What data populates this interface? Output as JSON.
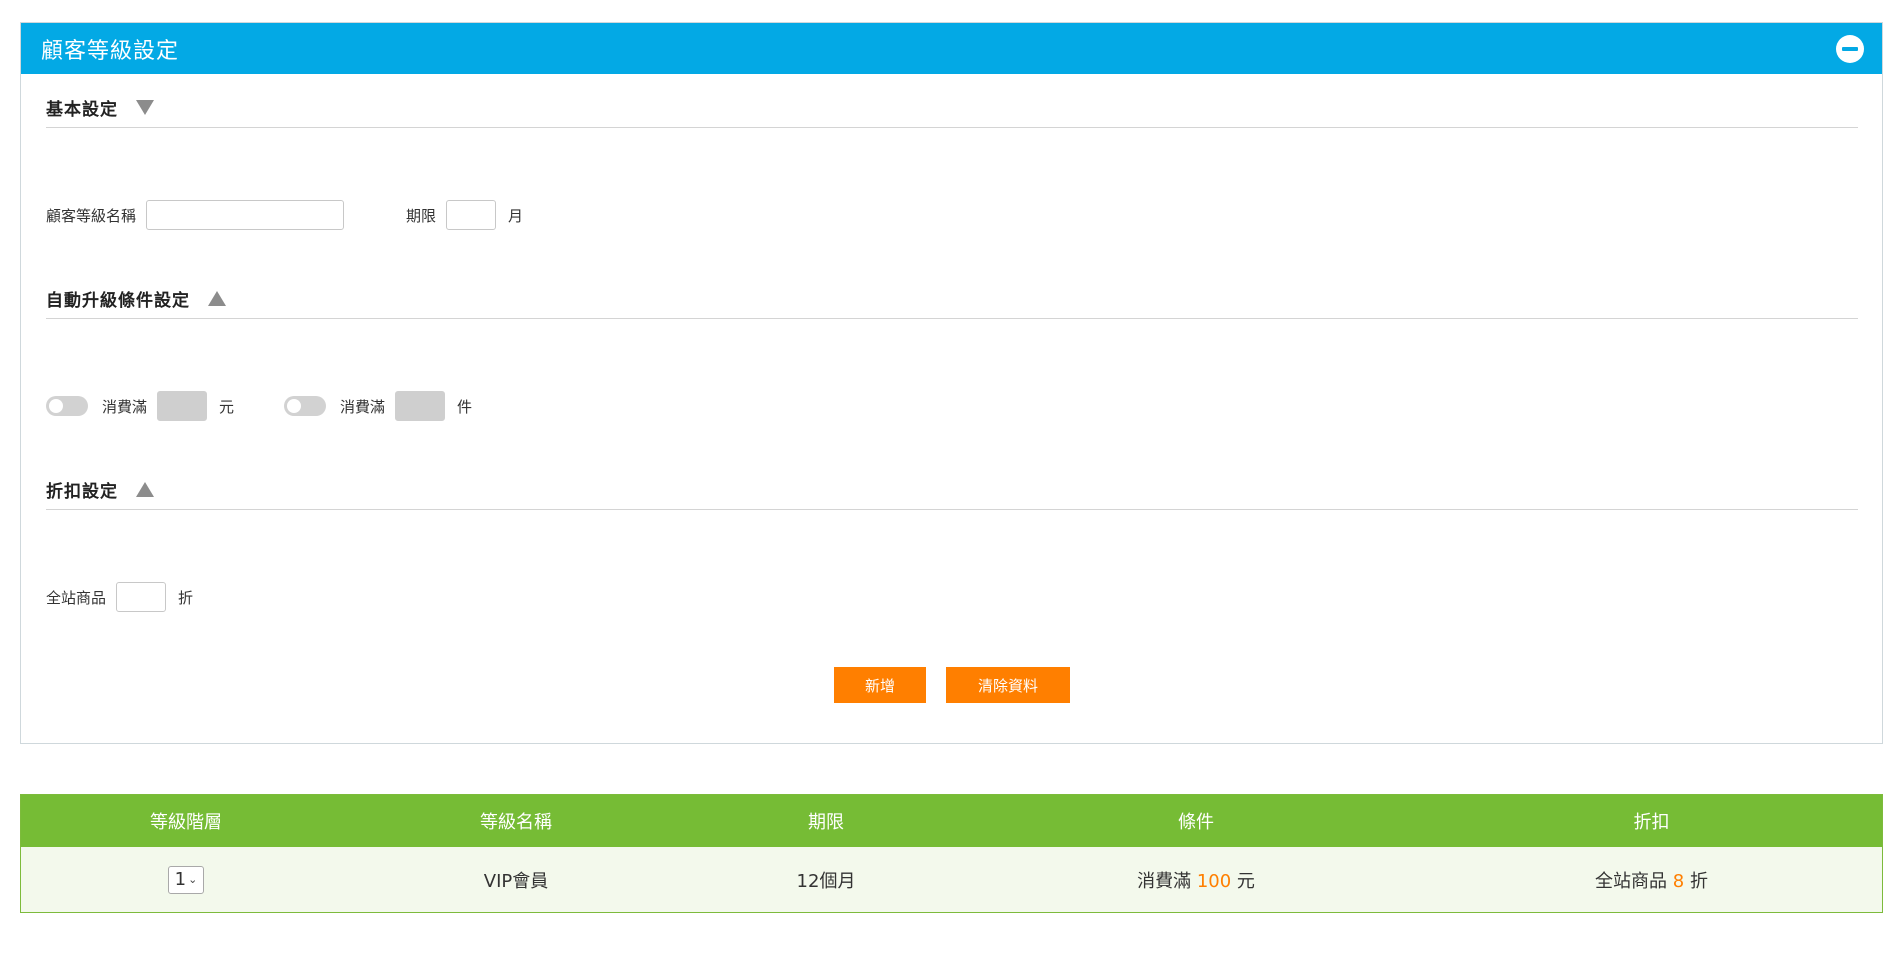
{
  "panel": {
    "title": "顧客等級設定"
  },
  "basic": {
    "title": "基本設定",
    "name_label": "顧客等級名稱",
    "name_value": "",
    "period_label": "期限",
    "period_value": "",
    "period_unit": "月"
  },
  "upgrade": {
    "title": "自動升級條件設定",
    "cond1_label": "消費滿",
    "cond1_unit": "元",
    "cond2_label": "消費滿",
    "cond2_unit": "件"
  },
  "discount": {
    "title": "折扣設定",
    "site_label": "全站商品",
    "site_unit": "折"
  },
  "buttons": {
    "add": "新增",
    "clear": "清除資料"
  },
  "table": {
    "headers": [
      "等級階層",
      "等級名稱",
      "期限",
      "條件",
      "折扣"
    ],
    "rows": [
      {
        "level": "1",
        "name": "VIP會員",
        "period": "12個月",
        "cond_prefix": "消費滿",
        "cond_value": "100",
        "cond_unit": "元",
        "disc_prefix": "全站商品",
        "disc_value": "8",
        "disc_unit": "折"
      }
    ]
  },
  "colors": {
    "header_blue": "#03a9e5",
    "accent_orange": "#ff7f00",
    "table_green": "#76bc35"
  }
}
